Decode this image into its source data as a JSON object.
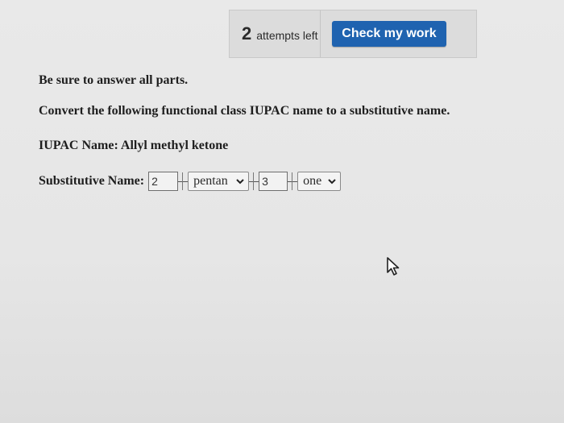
{
  "toolbar": {
    "attempts_count": "2",
    "attempts_label": "attempts left",
    "check_label": "Check my work",
    "check_color": "#1f63b0"
  },
  "question": {
    "instruction": "Be sure to answer all parts.",
    "prompt": "Convert the following functional class IUPAC name to a substitutive name.",
    "iupac_name": "IUPAC Name: Allyl methyl ketone",
    "answer_label": "Substitutive Name:"
  },
  "answer": {
    "position1": "2",
    "parent_chain": "pentan",
    "position2": "3",
    "suffix": "one"
  },
  "icons": {
    "dropdown": "chevron-down-icon",
    "pointer": "mouse-cursor-icon"
  }
}
